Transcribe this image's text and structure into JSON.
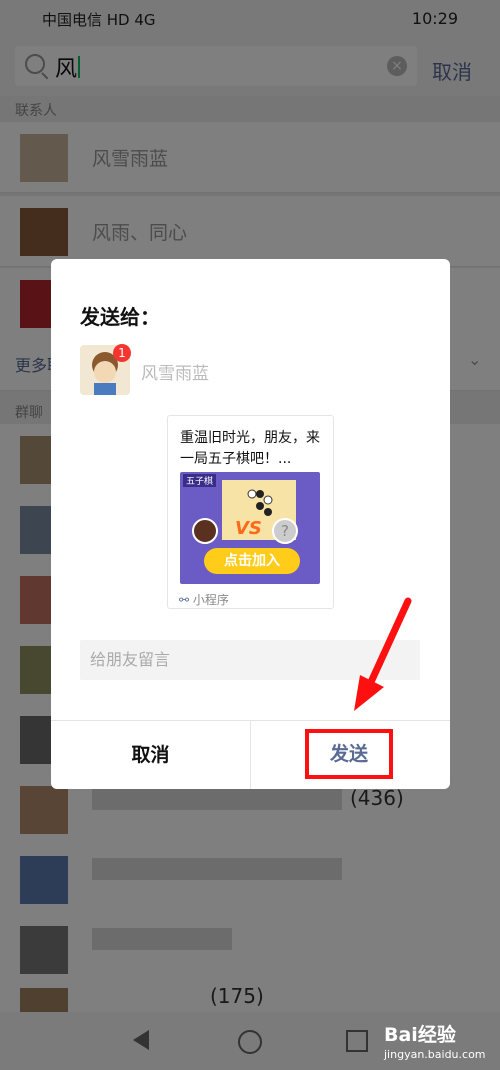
{
  "status": {
    "carrier": "中国电信 HD 4G",
    "time": "10:29"
  },
  "search": {
    "query": "风",
    "cancel": "取消"
  },
  "background": {
    "contacts_label": "联系人",
    "contact_names": [
      "风雪雨蓝",
      "风雨、同心"
    ],
    "more_label": "更多联",
    "groups_label": "群聊",
    "group_count": "(436)",
    "group_count2": "(175)"
  },
  "dialog": {
    "title": "发送给：",
    "recipient": "风雪雨蓝",
    "badge": "1",
    "card_title": "重温旧时光，朋友，来一局五子棋吧！...",
    "thumb_labels": {
      "game": "五子棋",
      "vs": "VS",
      "join": "点击加入"
    },
    "mini_program": "小程序",
    "message_placeholder": "给朋友留言",
    "cancel": "取消",
    "send": "发送"
  },
  "watermark": {
    "brand": "Bai经验",
    "url": "jingyan.baidu.com"
  },
  "colors": {
    "accent": "#576b95",
    "highlight": "#ff1010",
    "green": "#07c160"
  }
}
